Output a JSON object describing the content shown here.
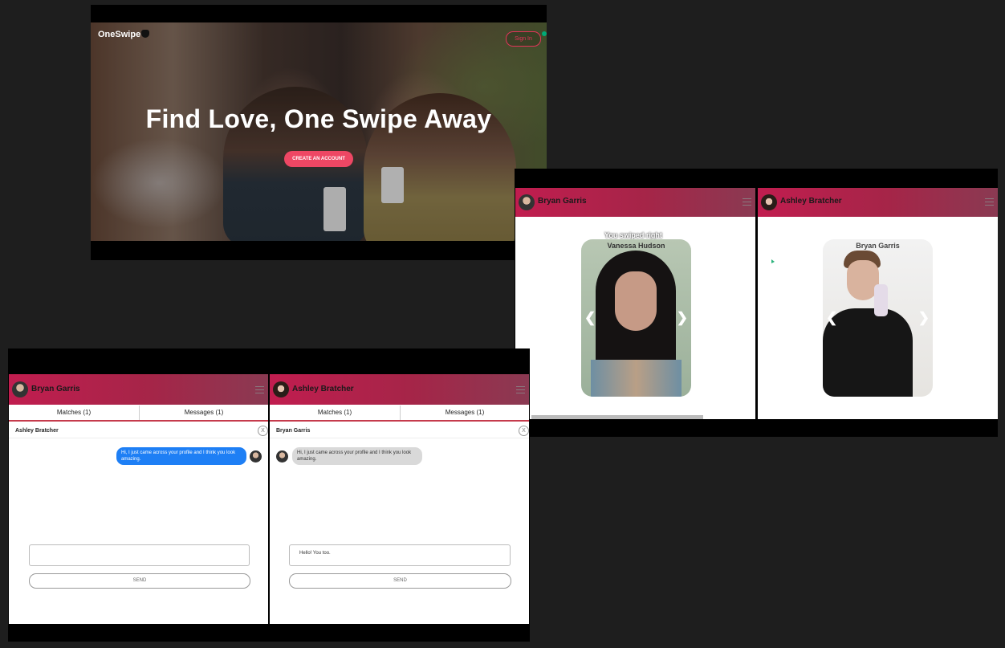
{
  "landing": {
    "logo_one": "One",
    "logo_swipe": "Swipe",
    "signin_label": "Sign In",
    "title": "Find Love, One Swipe Away",
    "cta_label": "CREATE AN ACCOUNT"
  },
  "swipe": {
    "left_user": "Bryan Garris",
    "right_user": "Ashley Bratcher",
    "swiped_notice": "You swiped right",
    "left_card_name": "Vanessa Hudson",
    "right_card_name": "Bryan Garris"
  },
  "chat": {
    "left_user": "Bryan Garris",
    "right_user": "Ashley Bratcher",
    "tab_matches": "Matches (1)",
    "tab_messages": "Messages (1)",
    "left_conv_with": "Ashley Bratcher",
    "right_conv_with": "Bryan Garris",
    "message_text": "Hi, I just came across your profile and I think you look amazing.",
    "left_input_value": "",
    "right_input_value": "Hello! You too.",
    "send_label": "SEND",
    "close_label": "X"
  },
  "colors": {
    "brand": "#c11d4f",
    "cta": "#ee4764",
    "bubble_me": "#1e7ff5",
    "bubble_them": "#d9d9d9"
  }
}
